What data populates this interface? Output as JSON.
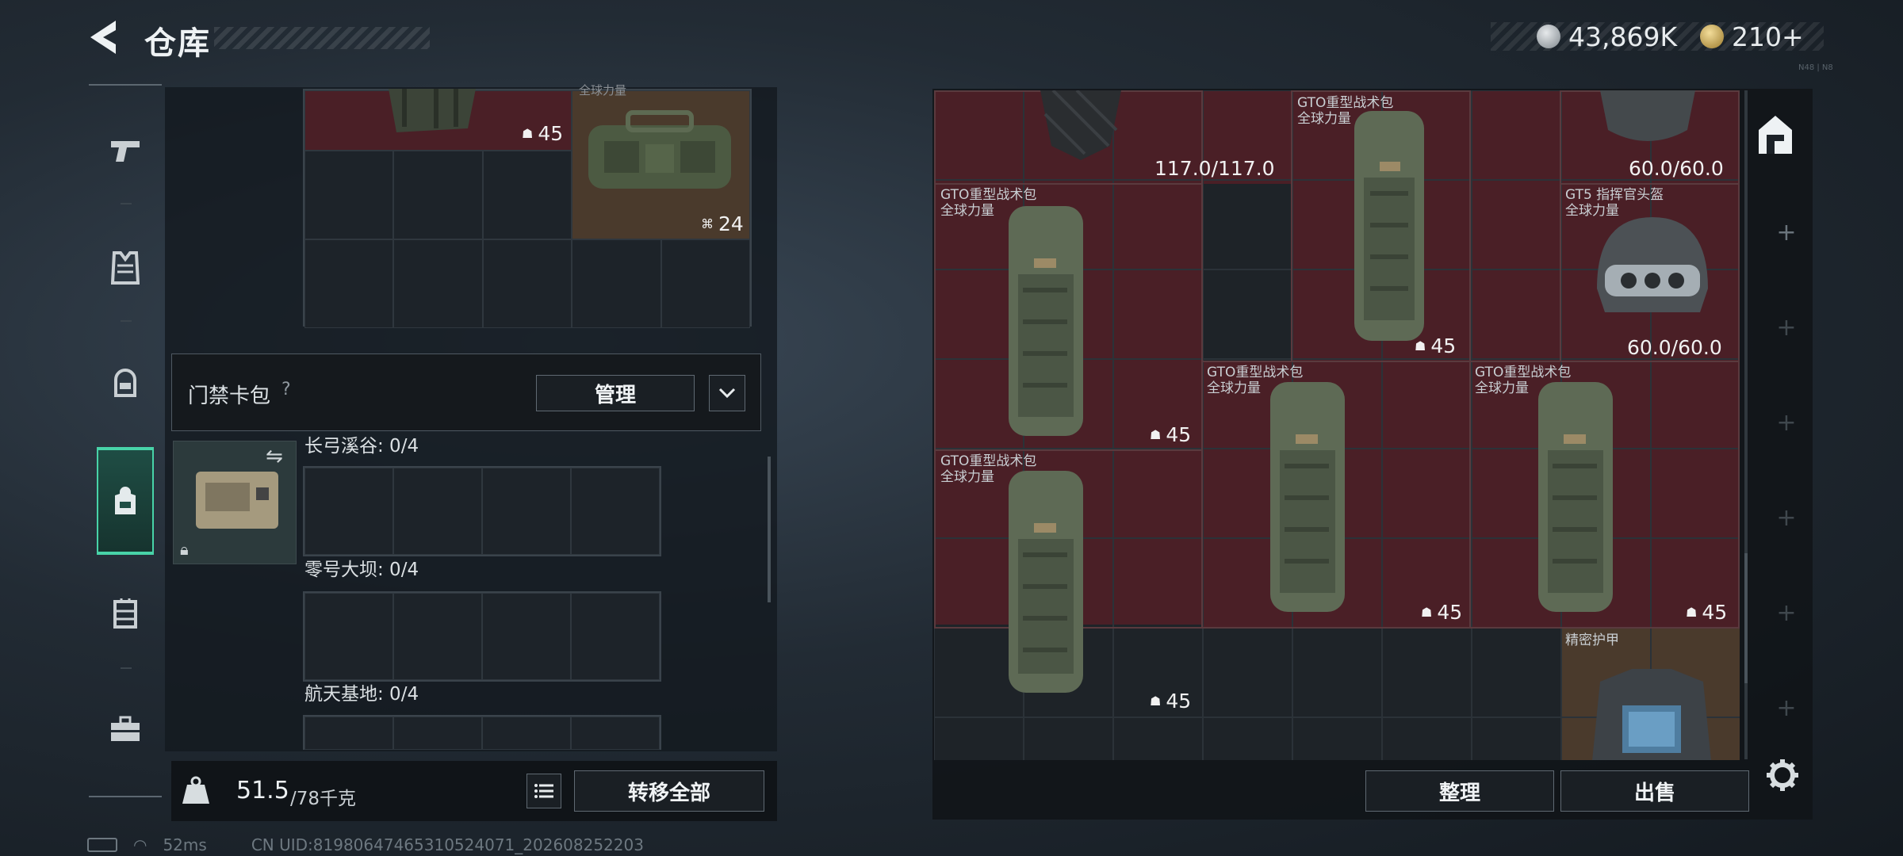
{
  "header": {
    "title": "仓库",
    "currency_silver": "43,869K",
    "currency_gold": "210+",
    "corner_note": "N48 | N8"
  },
  "nav": {
    "items": [
      {
        "name": "weapons",
        "icon": "pistol-icon"
      },
      {
        "name": "armor",
        "icon": "vest-icon"
      },
      {
        "name": "helmet",
        "icon": "helmet-icon"
      },
      {
        "name": "backpack",
        "icon": "backpack-icon",
        "active": true
      },
      {
        "name": "rig",
        "icon": "chest-rig-icon"
      },
      {
        "name": "case",
        "icon": "toolbox-icon"
      }
    ]
  },
  "left": {
    "top_items": [
      {
        "label": "全球力量",
        "qty": "45",
        "qty_icon": "backpack"
      },
      {
        "label": "",
        "qty": "24",
        "qty_icon": "vest"
      }
    ],
    "card_pack": {
      "title": "门禁卡包",
      "help": "?",
      "manage_label": "管理",
      "slots": [
        {
          "label": "长弓溪谷: 0/4"
        },
        {
          "label": "零号大坝: 0/4"
        },
        {
          "label": "航天基地: 0/4"
        }
      ]
    },
    "weight": {
      "current": "51.5",
      "max": "/78千克",
      "icon_text": "KG"
    },
    "transfer_all_label": "转移全部"
  },
  "right": {
    "items": [
      {
        "key": "armor_top",
        "label": "",
        "durability": "117.0/117.0"
      },
      {
        "key": "bag_top",
        "label": "GTO重型战术包",
        "label2": "全球力量",
        "qty": "45"
      },
      {
        "key": "helmet_top",
        "label": "",
        "durability": "60.0/60.0"
      },
      {
        "key": "bag_a",
        "label": "GTO重型战术包",
        "label2": "全球力量",
        "qty": "45"
      },
      {
        "key": "helmet_b",
        "label": "GT5 指挥官头盔",
        "label2": "全球力量",
        "durability": "60.0/60.0"
      },
      {
        "key": "bag_b",
        "label": "GTO重型战术包",
        "label2": "全球力量",
        "qty": "45"
      },
      {
        "key": "bag_c",
        "label": "GTO重型战术包",
        "label2": "全球力量",
        "qty": "45"
      },
      {
        "key": "bag_d",
        "label": "GTO重型战术包",
        "label2": "全球力量",
        "qty": "45"
      },
      {
        "key": "armor_precise",
        "label": "精密护甲"
      }
    ],
    "sort_label": "整理",
    "sell_label": "出售"
  },
  "footer": {
    "ping": "52ms",
    "uid": "CN UID:81980647465310524071_202608252203"
  },
  "colors": {
    "accent": "#48d3a8",
    "item_red": "#4a1f26",
    "item_gold": "#4a3a2c"
  }
}
